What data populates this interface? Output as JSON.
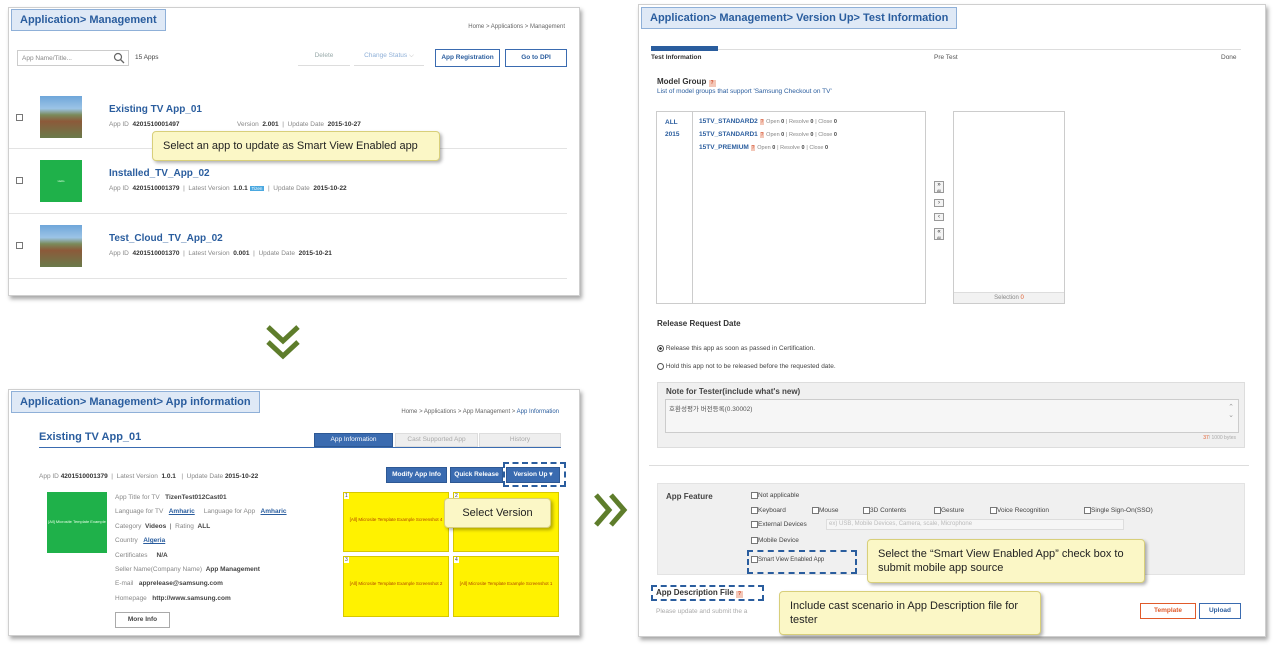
{
  "panel1": {
    "title": "Application> Management",
    "breadcrumb": "Home > Applications > Management",
    "search_placeholder": "App Name/Title...",
    "count": "15 Apps",
    "buttons": {
      "delete": "Delete",
      "change_status": "Change Status",
      "registration": "App Registration",
      "dpi": "Go to DPI"
    },
    "apps": [
      {
        "name": "Existing TV App_01",
        "id_label": "App ID",
        "id": "4201510001497",
        "ver_label": "Version",
        "version": "2.001",
        "date_label": "Update Date",
        "date": "2015-10-27"
      },
      {
        "name": "Installed_TV_App_02",
        "id_label": "App ID",
        "id": "4201510001379",
        "ver_label": "Latest Version",
        "version": "1.0.1",
        "badge": "Tizen",
        "date_label": "Update Date",
        "date": "2015-10-22"
      },
      {
        "name": "Test_Cloud_TV_App_02",
        "id_label": "App ID",
        "id": "4201510001370",
        "ver_label": "Latest Version",
        "version": "0.001",
        "date_label": "Update Date",
        "date": "2015-10-21"
      }
    ],
    "callout": "Select an app to update as Smart View Enabled app"
  },
  "panel2": {
    "title": "Application> Management> App information",
    "breadcrumb": "Home > Applications > App Management > ",
    "breadcrumb_current": "App Information",
    "app_name": "Existing TV App_01",
    "tabs": [
      "App Information",
      "Cast Supported App",
      "History"
    ],
    "id_label": "App ID",
    "id": "4201510001379",
    "ver_label": "Latest Version",
    "version": "1.0.1",
    "date_label": "Update Date",
    "date": "2015-10-22",
    "buttons": {
      "modify": "Modify App Info",
      "quick": "Quick Release",
      "version_up": "Version Up"
    },
    "thumb_text": "[All] Microsite Template Example",
    "fields": [
      {
        "label": "App Title for TV",
        "value": "TizenTest012Cast01"
      },
      {
        "label": "Language for TV",
        "value": "Amharic"
      },
      {
        "label": "Language for App",
        "value": "Amharic"
      },
      {
        "label": "Category",
        "value": "Videos"
      },
      {
        "label": "Rating",
        "value": "ALL"
      },
      {
        "label": "Country",
        "value": "Algeria"
      },
      {
        "label": "Certificates",
        "value": "N/A"
      },
      {
        "label": "Seller Name(Company Name)",
        "value": "App Management"
      },
      {
        "label": "E-mail",
        "value": "apprelease@samsung.com"
      },
      {
        "label": "Homepage",
        "value": "http://www.samsung.com"
      }
    ],
    "more": "More Info",
    "shots": [
      {
        "num": "1",
        "text": "[All] Microsite Template Example Screenshot 4"
      },
      {
        "num": "2",
        "text": "Screenshot 3"
      },
      {
        "num": "3",
        "text": "[All] Microsite Template Example Screenshot 2"
      },
      {
        "num": "4",
        "text": "[All] Microsite Template Example Screenshot 1"
      }
    ],
    "callout": "Select Version"
  },
  "panel3": {
    "title": "Application> Management> Version Up> Test Information",
    "steps": [
      "Test Information",
      "Pre Test",
      "Done"
    ],
    "model_group": "Model Group",
    "model_desc": "List of model groups that support 'Samsung Checkout on TV'",
    "years": [
      "ALL",
      "2015"
    ],
    "models": [
      {
        "name": "15TV_STANDARD2",
        "open": "Open",
        "open_n": "0",
        "resolve": "Resolve",
        "resolve_n": "0",
        "close": "Close",
        "close_n": "0"
      },
      {
        "name": "15TV_STANDARD1",
        "open": "Open",
        "open_n": "0",
        "resolve": "Resolve",
        "resolve_n": "0",
        "close": "Close",
        "close_n": "0"
      },
      {
        "name": "15TV_PREMIUM",
        "open": "Open",
        "open_n": "0",
        "resolve": "Resolve",
        "resolve_n": "0",
        "close": "Close",
        "close_n": "0"
      }
    ],
    "move_buttons": [
      "»",
      "›",
      "‹",
      "«"
    ],
    "move_sub": "All",
    "selection": "Selection",
    "selection_n": "0",
    "release_title": "Release Request Date",
    "release_opt1": "Release this app as soon as passed in Certification.",
    "release_opt2": "Hold this app not to be released before the requested date.",
    "note_title": "Note for Tester(include what's new)",
    "note_text": "호환성평가 버전등록(0.30002)",
    "note_count": "37",
    "note_max": "/ 1000 bytes",
    "feature_title": "App Feature",
    "features": [
      "Not applicable",
      "Keyboard",
      "Mouse",
      "3D Contents",
      "Gesture",
      "Voice Recognition",
      "Single Sign-On(SSO)",
      "External Devices",
      "Mobile Device",
      "Smart View Enabled App"
    ],
    "external_hint": "ex) USB, Mobile Devices, Camera, scale, Microphone",
    "desc_title": "App Description File",
    "desc_hint": "Please update and submit the a",
    "template": "Template",
    "upload": "Upload",
    "callout1": "Select the “Smart View Enabled App” check box to submit mobile app source",
    "callout2": "Include cast scenario in App Description file for tester"
  }
}
